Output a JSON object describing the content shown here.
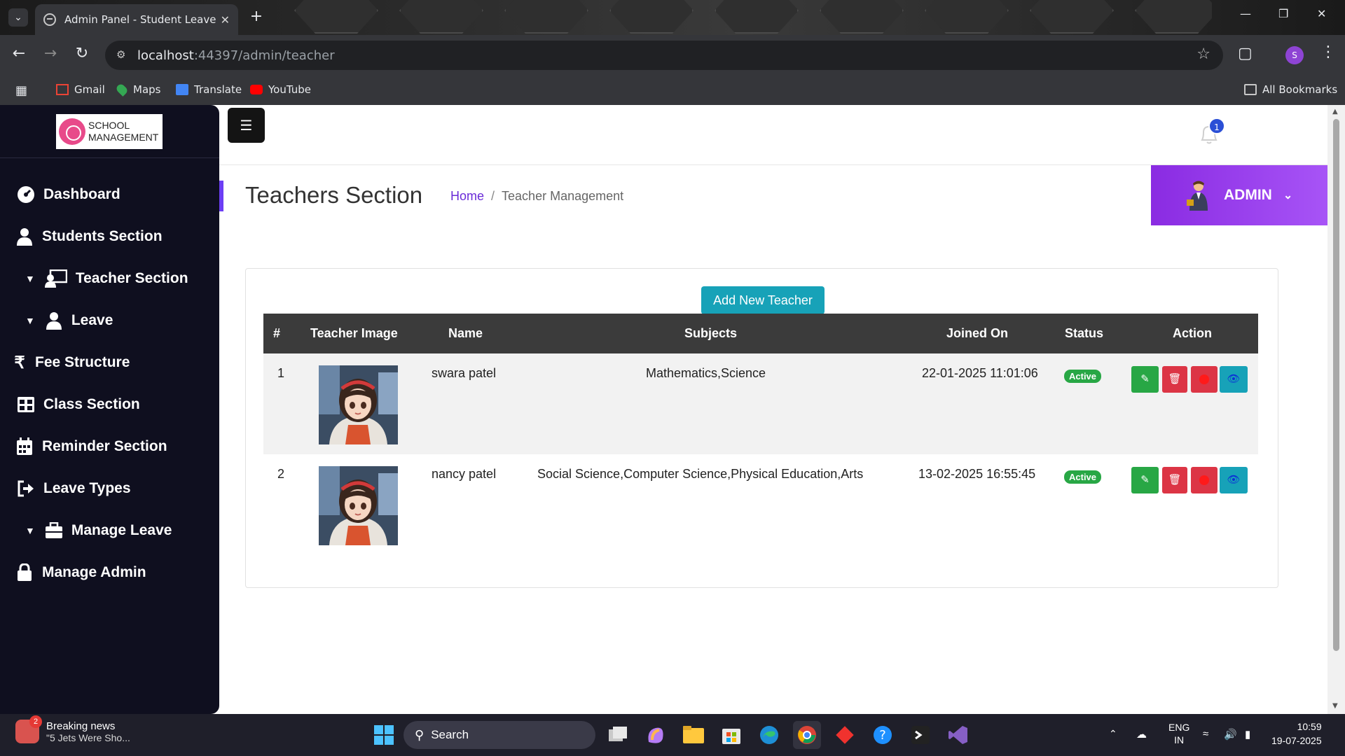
{
  "browser": {
    "tab_title": "Admin Panel - Student Leave",
    "url_host": "localhost",
    "url_path": ":44397/admin/teacher",
    "bookmarks": [
      "Gmail",
      "Maps",
      "Translate",
      "YouTube"
    ],
    "all_bookmarks": "All Bookmarks",
    "profile_initial": "S"
  },
  "sidebar": {
    "logo_line1": "SCHOOL",
    "logo_line2": "MANAGEMENT",
    "items": [
      {
        "label": "Dashboard",
        "icon": "dashboard-icon"
      },
      {
        "label": "Students Section",
        "icon": "user-icon"
      },
      {
        "label": "Teacher Section",
        "icon": "teacher-icon",
        "caret": true
      },
      {
        "label": "Leave",
        "icon": "user-icon",
        "caret": true
      },
      {
        "label": "Fee Structure",
        "icon": "rupee-icon"
      },
      {
        "label": "Class Section",
        "icon": "grid-icon"
      },
      {
        "label": "Reminder Section",
        "icon": "calendar-icon"
      },
      {
        "label": "Leave Types",
        "icon": "sign-out-icon"
      },
      {
        "label": "Manage Leave",
        "icon": "briefcase-icon",
        "caret": true
      },
      {
        "label": "Manage Admin",
        "icon": "lock-icon"
      }
    ]
  },
  "header": {
    "notification_count": "1",
    "page_title": "Teachers Section",
    "breadcrumb_home": "Home",
    "breadcrumb_sep": "/",
    "breadcrumb_current": "Teacher Management",
    "admin_label": "ADMIN"
  },
  "teachers": {
    "add_button": "Add New Teacher",
    "columns": [
      "#",
      "Teacher Image",
      "Name",
      "Subjects",
      "Joined On",
      "Status",
      "Action"
    ],
    "rows": [
      {
        "num": "1",
        "name": "swara patel",
        "subjects": "Mathematics,Science",
        "joined": "22-01-2025 11:01:06",
        "status": "Active"
      },
      {
        "num": "2",
        "name": "nancy patel",
        "subjects": "Social Science,Computer Science,Physical Education,Arts",
        "joined": "13-02-2025 16:55:45",
        "status": "Active"
      }
    ]
  },
  "colors": {
    "sidebar_bg": "#0f0f1f",
    "admin_accent": "#8a2be2",
    "add_button": "#17a2b8",
    "status_active": "#28a745",
    "action_edit": "#28a745",
    "action_delete": "#dc3545",
    "action_deactivate": "#dc3545",
    "action_view": "#17a2b8"
  },
  "taskbar": {
    "news_title": "Breaking news",
    "news_sub": "\"5 Jets Were Sho...",
    "news_badge": "2",
    "search_label": "Search",
    "lang_line1": "ENG",
    "lang_line2": "IN",
    "time": "10:59",
    "date": "19-07-2025"
  }
}
